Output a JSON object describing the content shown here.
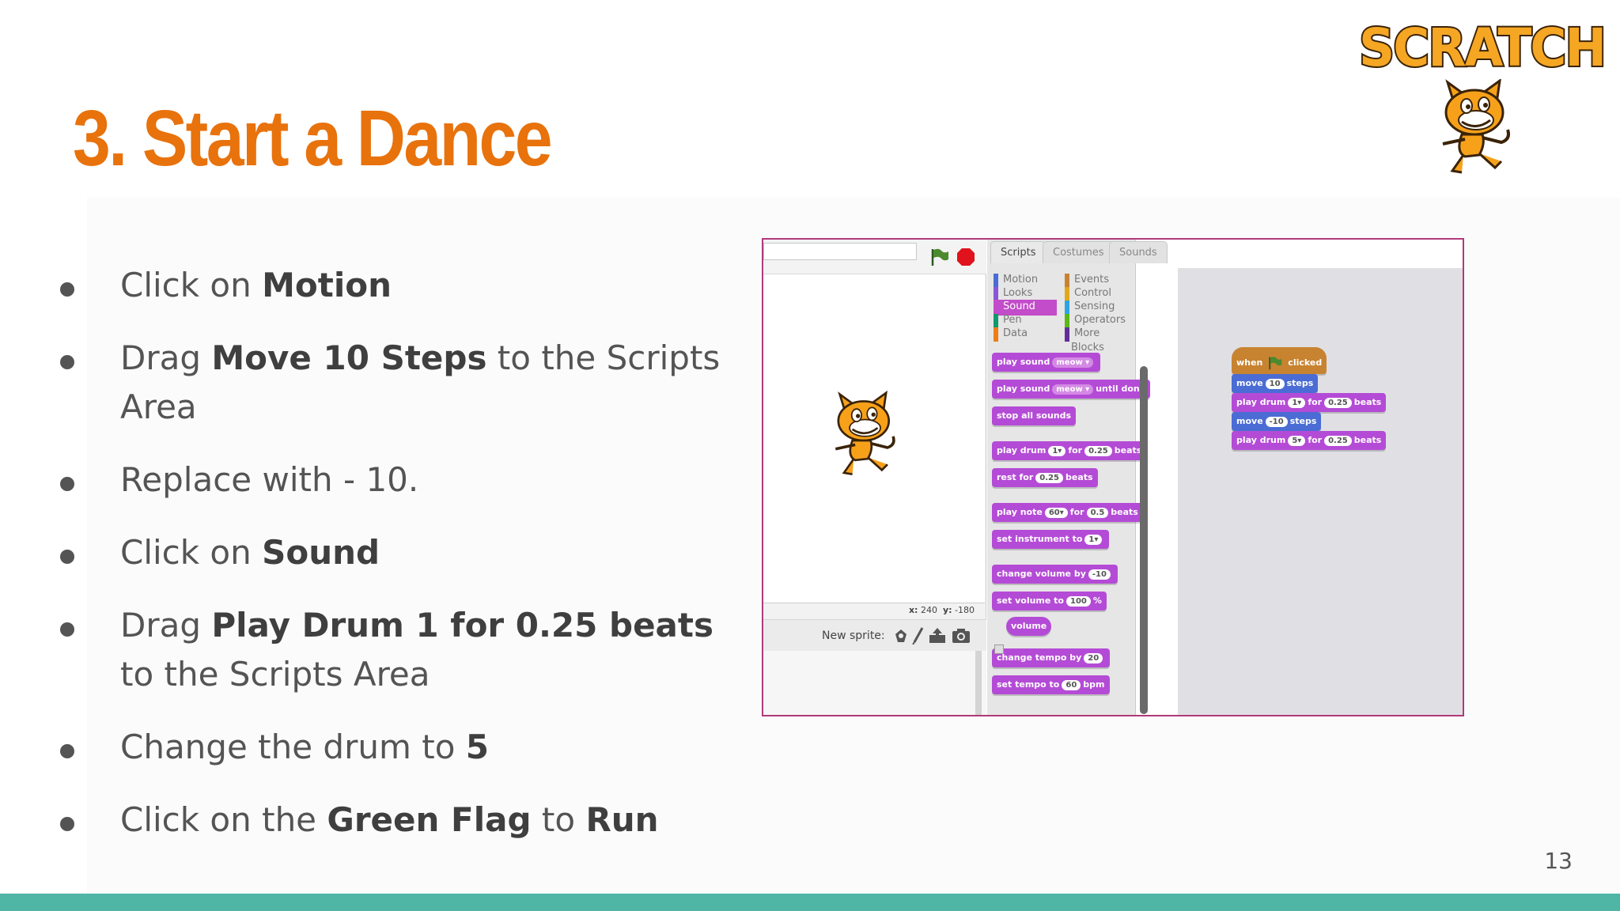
{
  "slide": {
    "title": "3. Start a Dance",
    "page_number": "13",
    "logo_text": "SCRATCH",
    "bullets": [
      {
        "parts": [
          {
            "t": "Click on ",
            "b": false
          },
          {
            "t": "Motion",
            "b": true
          }
        ]
      },
      {
        "parts": [
          {
            "t": "Drag ",
            "b": false
          },
          {
            "t": "Move 10 Steps",
            "b": true
          },
          {
            "t": " to the Scripts Area",
            "b": false
          }
        ]
      },
      {
        "parts": [
          {
            "t": "Replace with - 10.",
            "b": false
          }
        ]
      },
      {
        "parts": [
          {
            "t": "Click on ",
            "b": false
          },
          {
            "t": "Sound",
            "b": true
          }
        ]
      },
      {
        "parts": [
          {
            "t": "Drag ",
            "b": false
          },
          {
            "t": "Play Drum 1 for 0.25 beats",
            "b": true
          },
          {
            "t": " to the Scripts Area",
            "b": false
          }
        ]
      },
      {
        "parts": [
          {
            "t": "Change the drum to ",
            "b": false
          },
          {
            "t": "5",
            "b": true
          }
        ]
      },
      {
        "parts": [
          {
            "t": "Click on the ",
            "b": false
          },
          {
            "t": "Green Flag",
            "b": true
          },
          {
            "t": " to ",
            "b": false
          },
          {
            "t": "Run",
            "b": true
          }
        ]
      }
    ]
  },
  "colors": {
    "title": "#e8720c",
    "bottom_bar": "#4fb5a5",
    "screenshot_border": "#b03a7a",
    "sound_block": "#b44bd6",
    "motion_block": "#4a6cd4",
    "event_block": "#c88330"
  },
  "scratch": {
    "tabs": [
      "Scripts",
      "Costumes",
      "Sounds"
    ],
    "active_tab": "Scripts",
    "categories_left": [
      {
        "label": "Motion",
        "color": "#4a6cd4"
      },
      {
        "label": "Looks",
        "color": "#8a55d7"
      },
      {
        "label": "Sound",
        "color": "#c24cc9",
        "active": true
      },
      {
        "label": "Pen",
        "color": "#0e9a6c"
      },
      {
        "label": "Data",
        "color": "#ee7d16"
      }
    ],
    "categories_right": [
      {
        "label": "Events",
        "color": "#c88330"
      },
      {
        "label": "Control",
        "color": "#e1a91a"
      },
      {
        "label": "Sensing",
        "color": "#2ca5e2"
      },
      {
        "label": "Operators",
        "color": "#5cb712"
      },
      {
        "label": "More Blocks",
        "color": "#632d99"
      }
    ],
    "coords": {
      "x_label": "x:",
      "x_value": "240",
      "y_label": "y:",
      "y_value": "-180"
    },
    "new_sprite_label": "New sprite:",
    "palette_blocks": {
      "play_sound": {
        "pre": "play sound",
        "arg": "meow"
      },
      "play_sound_until": {
        "pre": "play sound",
        "arg": "meow",
        "post": "until done"
      },
      "stop_all": {
        "pre": "stop all sounds"
      },
      "play_drum": {
        "pre": "play drum",
        "arg1": "1",
        "mid": "for",
        "arg2": "0.25",
        "post": "beats"
      },
      "rest_for": {
        "pre": "rest for",
        "arg": "0.25",
        "post": "beats"
      },
      "play_note": {
        "pre": "play note",
        "arg1": "60",
        "mid": "for",
        "arg2": "0.5",
        "post": "beats"
      },
      "set_instrument": {
        "pre": "set instrument to",
        "arg": "1"
      },
      "change_volume": {
        "pre": "change volume by",
        "arg": "-10"
      },
      "set_volume": {
        "pre": "set volume to",
        "arg": "100",
        "post": "%"
      },
      "volume": {
        "pre": "volume"
      },
      "change_tempo": {
        "pre": "change tempo by",
        "arg": "20"
      },
      "set_tempo": {
        "pre": "set tempo to",
        "arg": "60",
        "post": "bpm"
      }
    },
    "script": {
      "hat": {
        "pre": "when",
        "post": "clicked"
      },
      "move1": {
        "pre": "move",
        "arg": "10",
        "post": "steps"
      },
      "drum1": {
        "pre": "play drum",
        "arg1": "1",
        "mid": "for",
        "arg2": "0.25",
        "post": "beats"
      },
      "move2": {
        "pre": "move",
        "arg": "-10",
        "post": "steps"
      },
      "drum2": {
        "pre": "play drum",
        "arg1": "5",
        "mid": "for",
        "arg2": "0.25",
        "post": "beats"
      }
    }
  }
}
